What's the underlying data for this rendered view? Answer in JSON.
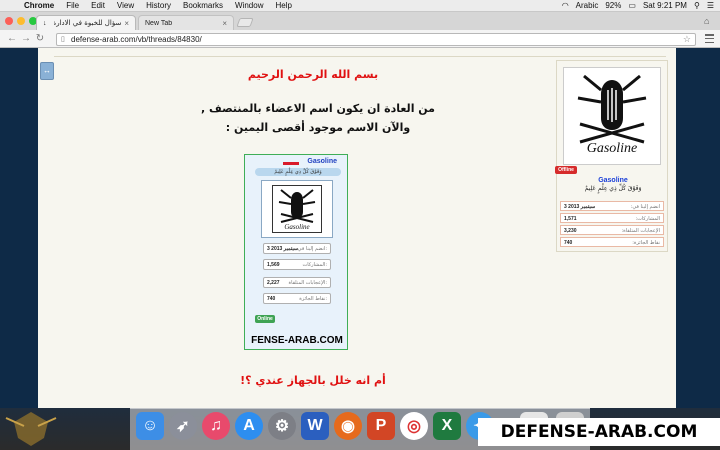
{
  "menubar": {
    "app_name": "Chrome",
    "items": [
      "File",
      "Edit",
      "View",
      "History",
      "Bookmarks",
      "Window",
      "Help"
    ],
    "status": {
      "language": "Arabic",
      "battery": "92%",
      "time": "Sat 9:21 PM"
    }
  },
  "tabs": [
    {
      "title": "سؤال للخبوة في الادارة عن تغيير",
      "active": true
    },
    {
      "title": "New Tab",
      "active": false
    }
  ],
  "address_bar": {
    "url": "defense-arab.com/vb/threads/84830/"
  },
  "post": {
    "basmala": "بسم الله الرحمن الرحيم",
    "line1": "من العادة ان يكون اسم الاعضاء بالمنتصف ,",
    "line2": "والآن الاسم موجود أقصى اليمين :",
    "question": "أم انه خلل بالجهاز عندي ؟!"
  },
  "embedded_screenshot": {
    "username": "Gasoline",
    "motto": "وَفَوْقَ كُلِّ ذِي عِلْمٍ عَلِيمٌ",
    "stats": [
      {
        "label": "انضم إلينا في:",
        "value": "3 سبتمبر 2013"
      },
      {
        "label": "المشاركات:",
        "value": "1,569"
      },
      {
        "label": "الإعجابات المتلقاة:",
        "value": "2,227"
      },
      {
        "label": "نقاط الجائزة:",
        "value": "740"
      }
    ],
    "status": "Online",
    "site_caption": "FENSE-ARAB.COM"
  },
  "profile": {
    "avatar_text": "Gasoline",
    "status": "Offline",
    "username": "Gasoline",
    "motto": "وَفَوْقَ كُلِّ ذِي عِلْمٍ عَلِيمٌ",
    "stats": [
      {
        "label": "انضم إلينا في:",
        "value": "3 سبتمبر 2013"
      },
      {
        "label": "المشاركات:",
        "value": "1,571"
      },
      {
        "label": "الإعجابات المتلقاة:",
        "value": "3,230"
      },
      {
        "label": "نقاط الجائزة:",
        "value": "740"
      }
    ]
  },
  "dock": {
    "icons": [
      "finder-icon",
      "launchpad-icon",
      "itunes-icon",
      "app-store-icon",
      "system-preferences-icon",
      "word-icon",
      "firefox-icon",
      "powerpoint-icon",
      "chrome-icon",
      "excel-icon",
      "safari-icon",
      "preview-icon",
      "utility-icon"
    ]
  },
  "watermark": "DEFENSE-ARAB.COM",
  "colors": {
    "accent_red": "#e01111",
    "username_blue": "#1a3fd8",
    "online_green": "#3fa354",
    "offline_red": "#d62b2b"
  }
}
